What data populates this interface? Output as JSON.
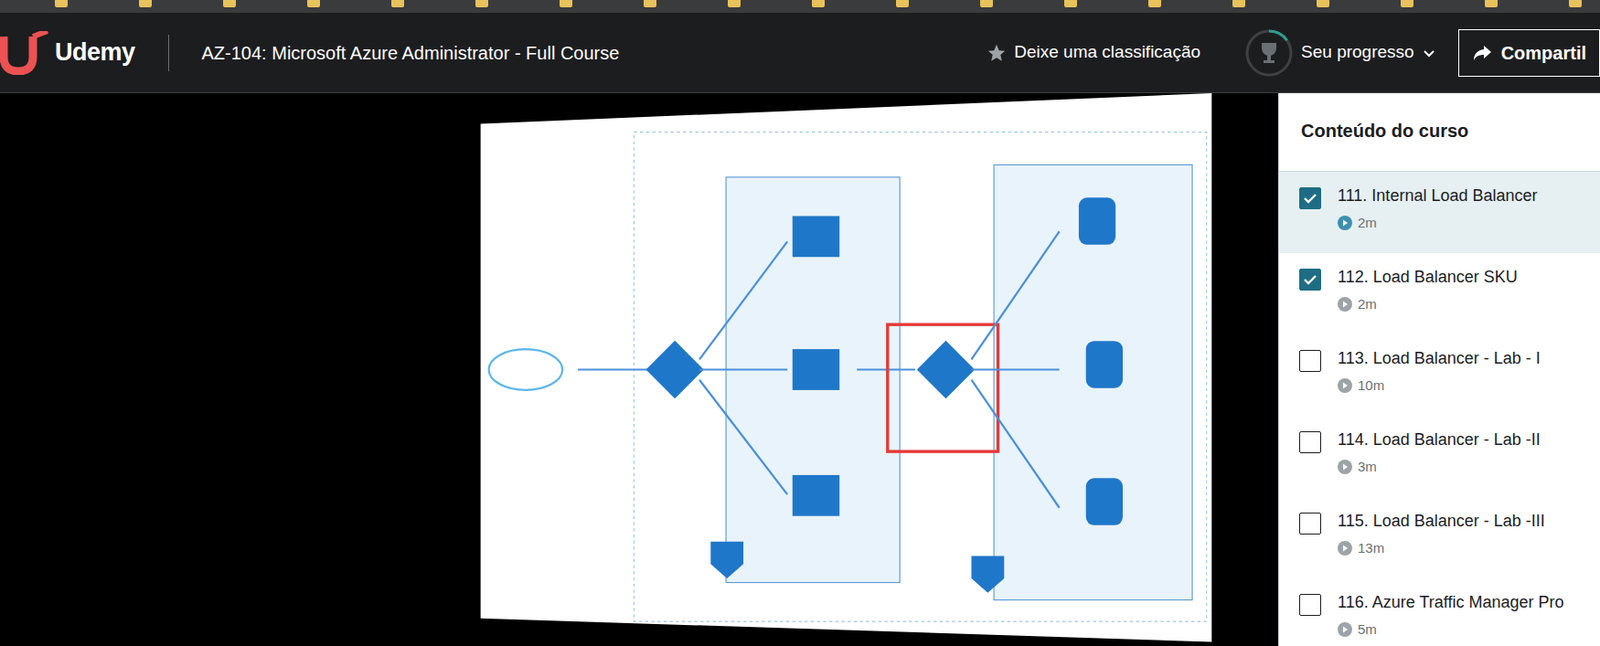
{
  "header": {
    "logo": "Udemy",
    "title": "AZ-104: Microsoft Azure Administrator - Full Course",
    "rating": "Deixe uma classificação",
    "progress": {
      "label": "Seu progresso",
      "level": 0.15
    },
    "share": "Compartil"
  },
  "sidebar": {
    "title": "Conteúdo do curso",
    "items": [
      {
        "title": "111. Internal Load Balancer",
        "duration": "2m",
        "checked": true,
        "selected": true
      },
      {
        "title": "112. Load Balancer SKU",
        "duration": "2m",
        "checked": true,
        "selected": false
      },
      {
        "title": "113. Load Balancer - Lab - I",
        "duration": "10m",
        "checked": false,
        "selected": false
      },
      {
        "title": "114. Load Balancer - Lab -II",
        "duration": "3m",
        "checked": false,
        "selected": false
      },
      {
        "title": "115. Load Balancer - Lab -III",
        "duration": "13m",
        "checked": false,
        "selected": false
      },
      {
        "title": "116. Azure Traffic Manager Pro",
        "duration": "5m",
        "checked": false,
        "selected": false
      }
    ]
  }
}
